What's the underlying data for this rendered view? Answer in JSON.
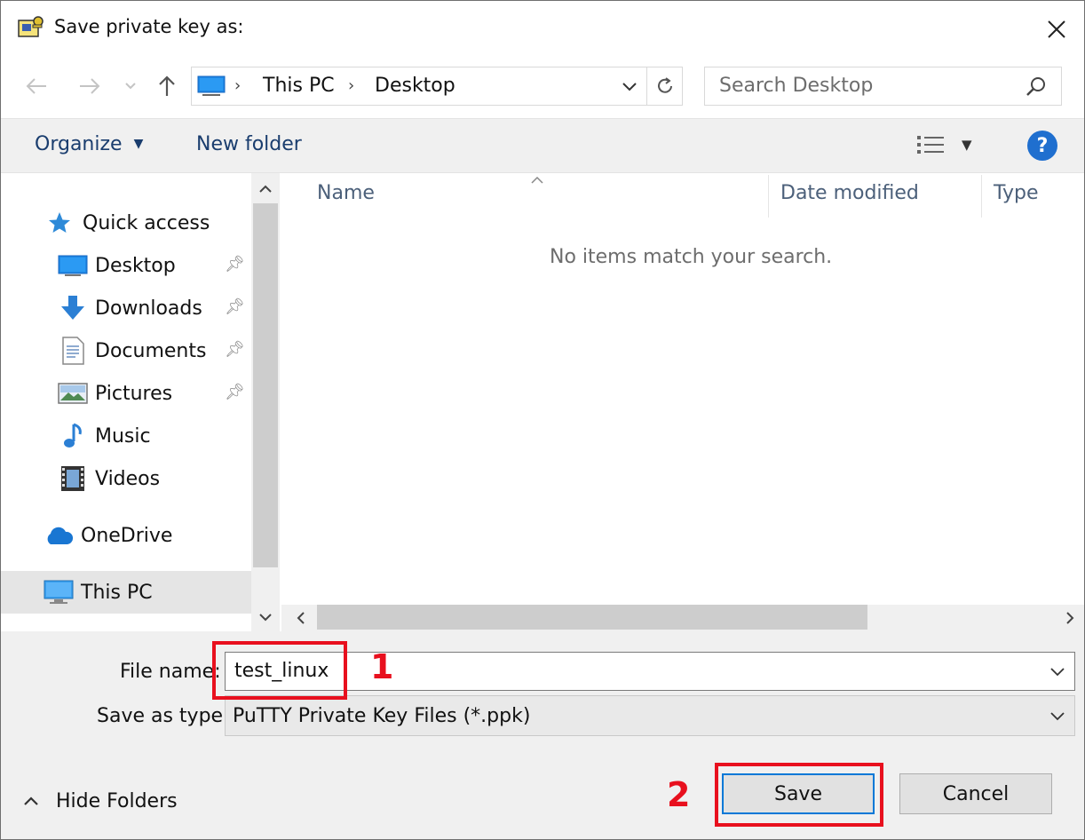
{
  "window": {
    "title": "Save private key as:"
  },
  "nav": {
    "breadcrumb": [
      "This PC",
      "Desktop"
    ],
    "search_placeholder": "Search Desktop"
  },
  "toolbar": {
    "organize_label": "Organize",
    "new_folder_label": "New folder",
    "help_glyph": "?"
  },
  "sidebar": {
    "quick_access": "Quick access",
    "items": [
      {
        "label": "Desktop",
        "icon": "desktop-icon",
        "pinned": true
      },
      {
        "label": "Downloads",
        "icon": "downloads-icon",
        "pinned": true
      },
      {
        "label": "Documents",
        "icon": "documents-icon",
        "pinned": true
      },
      {
        "label": "Pictures",
        "icon": "pictures-icon",
        "pinned": true
      },
      {
        "label": "Music",
        "icon": "music-icon",
        "pinned": false
      },
      {
        "label": "Videos",
        "icon": "videos-icon",
        "pinned": false
      }
    ],
    "onedrive": "OneDrive",
    "this_pc": "This PC"
  },
  "columns": [
    "Name",
    "Date modified",
    "Type"
  ],
  "content": {
    "empty_message": "No items match your search."
  },
  "form": {
    "file_name_label": "File name:",
    "file_name_value": "test_linux",
    "save_type_label": "Save as type:",
    "save_type_value": "PuTTY Private Key Files (*.ppk)"
  },
  "footer": {
    "hide_folders_label": "Hide Folders",
    "save_label": "Save",
    "cancel_label": "Cancel"
  },
  "annotations": {
    "step1": "1",
    "step2": "2"
  },
  "colors": {
    "accent": "#0078d7",
    "annotation": "#e8101e",
    "link_text": "#1a3d6e"
  }
}
